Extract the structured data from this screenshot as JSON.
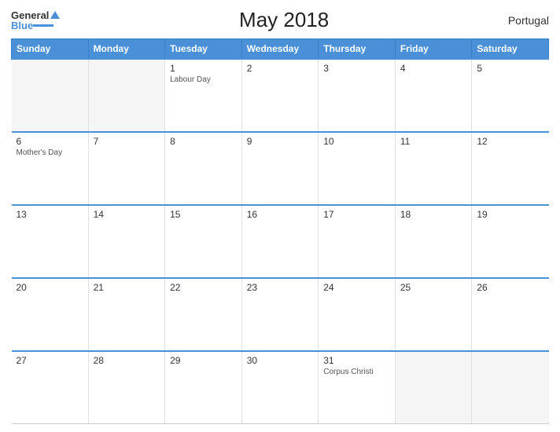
{
  "header": {
    "title": "May 2018",
    "country": "Portugal",
    "logo": {
      "general": "General",
      "blue": "Blue"
    }
  },
  "columns": [
    "Sunday",
    "Monday",
    "Tuesday",
    "Wednesday",
    "Thursday",
    "Friday",
    "Saturday"
  ],
  "weeks": [
    [
      {
        "day": "",
        "holiday": ""
      },
      {
        "day": "",
        "holiday": ""
      },
      {
        "day": "1",
        "holiday": "Labour Day"
      },
      {
        "day": "2",
        "holiday": ""
      },
      {
        "day": "3",
        "holiday": ""
      },
      {
        "day": "4",
        "holiday": ""
      },
      {
        "day": "5",
        "holiday": ""
      }
    ],
    [
      {
        "day": "6",
        "holiday": "Mother's Day"
      },
      {
        "day": "7",
        "holiday": ""
      },
      {
        "day": "8",
        "holiday": ""
      },
      {
        "day": "9",
        "holiday": ""
      },
      {
        "day": "10",
        "holiday": ""
      },
      {
        "day": "11",
        "holiday": ""
      },
      {
        "day": "12",
        "holiday": ""
      }
    ],
    [
      {
        "day": "13",
        "holiday": ""
      },
      {
        "day": "14",
        "holiday": ""
      },
      {
        "day": "15",
        "holiday": ""
      },
      {
        "day": "16",
        "holiday": ""
      },
      {
        "day": "17",
        "holiday": ""
      },
      {
        "day": "18",
        "holiday": ""
      },
      {
        "day": "19",
        "holiday": ""
      }
    ],
    [
      {
        "day": "20",
        "holiday": ""
      },
      {
        "day": "21",
        "holiday": ""
      },
      {
        "day": "22",
        "holiday": ""
      },
      {
        "day": "23",
        "holiday": ""
      },
      {
        "day": "24",
        "holiday": ""
      },
      {
        "day": "25",
        "holiday": ""
      },
      {
        "day": "26",
        "holiday": ""
      }
    ],
    [
      {
        "day": "27",
        "holiday": ""
      },
      {
        "day": "28",
        "holiday": ""
      },
      {
        "day": "29",
        "holiday": ""
      },
      {
        "day": "30",
        "holiday": ""
      },
      {
        "day": "31",
        "holiday": "Corpus Christi"
      },
      {
        "day": "",
        "holiday": ""
      },
      {
        "day": "",
        "holiday": ""
      }
    ]
  ]
}
